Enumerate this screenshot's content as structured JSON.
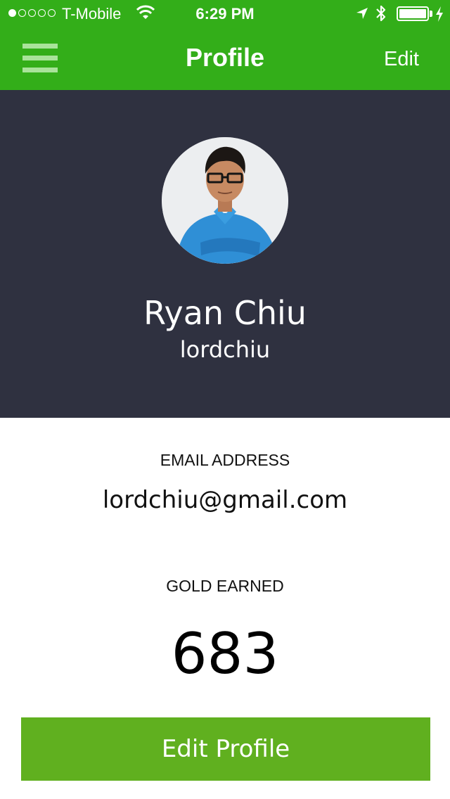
{
  "status_bar": {
    "carrier": "T-Mobile",
    "time": "6:29 PM",
    "signal_bars_filled": 1,
    "signal_bars_total": 5,
    "battery_level": 1.0
  },
  "nav": {
    "title": "Profile",
    "edit_label": "Edit",
    "menu_icon": "hamburger-menu-icon",
    "bar_color": "#33ae19"
  },
  "profile": {
    "name": "Ryan Chiu",
    "username": "lordchiu",
    "avatar_icon": "profile-photo",
    "header_color": "#2f3140"
  },
  "details": {
    "email_label": "EMAIL ADDRESS",
    "email": "lordchiu@gmail.com",
    "gold_label": "GOLD EARNED",
    "gold": "683"
  },
  "actions": {
    "edit_profile_label": "Edit Profile",
    "button_color": "#60b01f"
  }
}
